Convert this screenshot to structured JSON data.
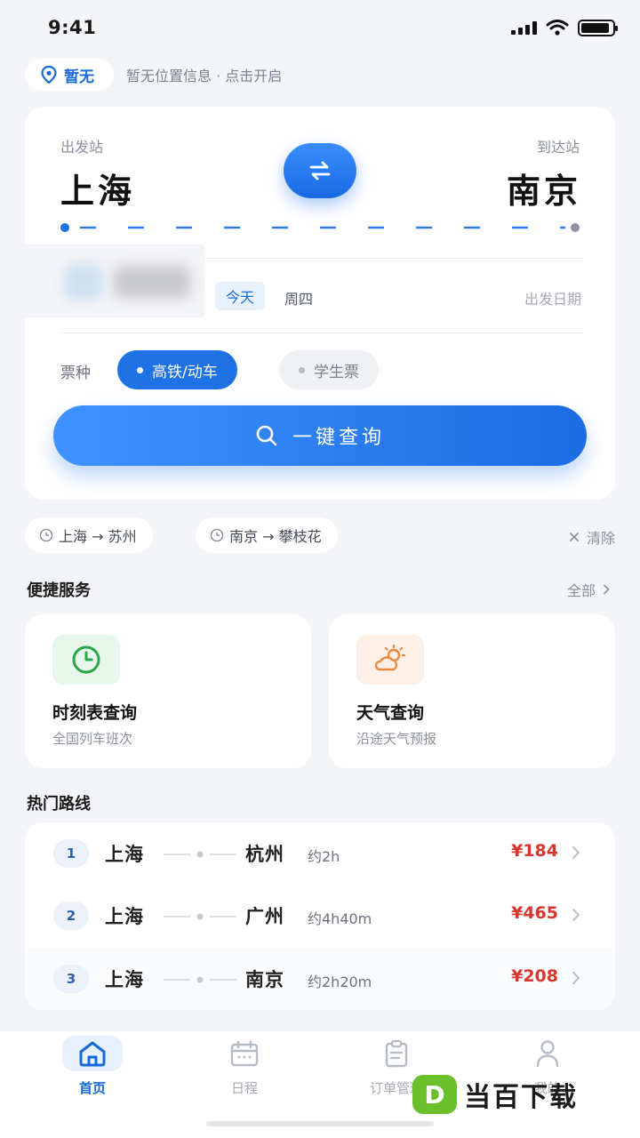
{
  "status_bar": {
    "time": "9:41",
    "battery_level": 0.9
  },
  "location": {
    "pill_label": "暂无",
    "hint": "暂无位置信息 · 点击开启"
  },
  "search": {
    "from_label": "出发站",
    "from_station": "上海",
    "to_label": "到达站",
    "to_station": "南京",
    "today_tag": "今天",
    "weekday": "周四",
    "date_label": "出发日期",
    "ticket_type_label": "票种",
    "ticket_types": [
      {
        "label": "高铁/动车",
        "selected": true
      },
      {
        "label": "学生票",
        "selected": false
      }
    ],
    "query_button": "一键查询"
  },
  "history": {
    "items": [
      {
        "label": "上海 → 苏州"
      },
      {
        "label": "南京 → 攀枝花"
      }
    ],
    "clear_label": "清除"
  },
  "services": {
    "title": "便捷服务",
    "see_all": "全部",
    "items": [
      {
        "title": "时刻表查询",
        "subtitle": "全国列车班次",
        "icon": "clock-icon",
        "tint": "#e8f7ec",
        "color": "#2aa748"
      },
      {
        "title": "天气查询",
        "subtitle": "沿途天气预报",
        "icon": "weather-icon",
        "tint": "#fdf0e7",
        "color": "#e98a3c"
      }
    ]
  },
  "popular_routes": {
    "title": "热门路线",
    "routes": [
      {
        "rank": "1",
        "from": "上海",
        "to": "杭州",
        "duration": "约2h",
        "price": "¥184"
      },
      {
        "rank": "2",
        "from": "上海",
        "to": "广州",
        "duration": "约4h40m",
        "price": "¥465"
      },
      {
        "rank": "3",
        "from": "上海",
        "to": "南京",
        "duration": "约2h20m",
        "price": "¥208"
      }
    ]
  },
  "tab_bar": {
    "tabs": [
      {
        "label": "首页",
        "icon": "home-icon",
        "active": true
      },
      {
        "label": "日程",
        "icon": "calendar-icon",
        "active": false
      },
      {
        "label": "订单管理",
        "icon": "clipboard-icon",
        "active": false
      },
      {
        "label": "我的",
        "icon": "user-icon",
        "active": false
      }
    ]
  },
  "watermark": {
    "logo_letter": "D",
    "text": "当百下载"
  },
  "colors": {
    "accent": "#1f72e6",
    "price": "#d8362e",
    "background": "#f3f5f9"
  }
}
